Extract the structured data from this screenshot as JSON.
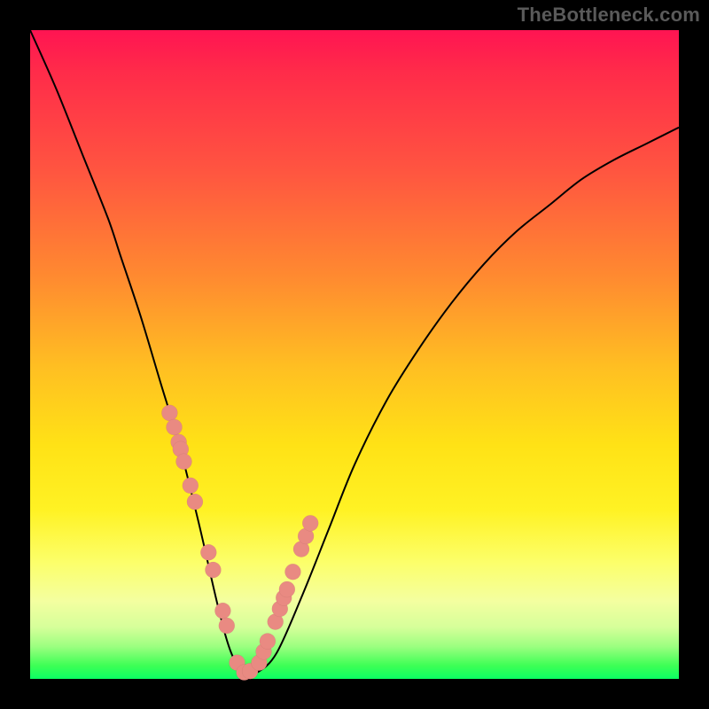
{
  "watermark_text": "TheBottleneck.com",
  "colors": {
    "background": "#000000",
    "curve": "#000000",
    "dots": "#e98a82"
  },
  "chart_data": {
    "type": "line",
    "title": "",
    "xlabel": "",
    "ylabel": "",
    "xlim": [
      0,
      100
    ],
    "ylim": [
      0,
      100
    ],
    "series": [
      {
        "name": "bottleneck-curve",
        "x": [
          0,
          4,
          8,
          12,
          14,
          17,
          20,
          23,
          26,
          29,
          31,
          33,
          35,
          38,
          42,
          46,
          50,
          55,
          60,
          65,
          70,
          75,
          80,
          85,
          90,
          95,
          100
        ],
        "values": [
          100,
          91,
          81,
          71,
          65,
          56,
          46,
          36,
          24,
          11,
          4,
          1,
          1,
          4,
          13,
          23,
          33,
          43,
          51,
          58,
          64,
          69,
          73,
          77,
          80,
          82.5,
          85
        ]
      }
    ],
    "overlay_points": {
      "name": "highlighted-points",
      "series": "bottleneck-curve",
      "x": [
        21.5,
        22.2,
        22.9,
        23.2,
        23.7,
        24.7,
        25.4,
        27.5,
        28.2,
        29.7,
        30.3,
        31.9,
        33.0,
        33.9,
        35.3,
        36.0,
        36.6,
        37.8,
        38.5,
        39.1,
        39.6,
        40.5,
        41.8,
        42.5,
        43.2
      ],
      "values": [
        41.0,
        38.8,
        36.5,
        35.4,
        33.5,
        29.8,
        27.3,
        19.5,
        16.8,
        10.5,
        8.2,
        2.5,
        1.0,
        1.2,
        2.5,
        4.2,
        5.8,
        8.8,
        10.8,
        12.5,
        13.8,
        16.5,
        20.0,
        22.0,
        24.0
      ]
    },
    "background_gradient": {
      "top_color": "#ff1452",
      "bottom_color": "#0bff63"
    }
  }
}
